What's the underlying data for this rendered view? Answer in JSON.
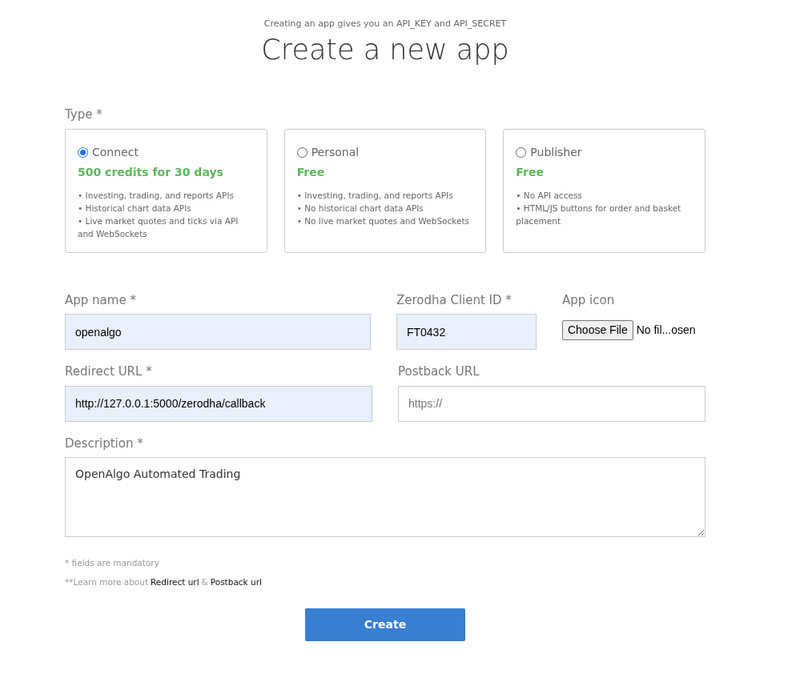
{
  "header": {
    "subtitle": "Creating an app gives you an API_KEY and API_SECRET",
    "title": "Create a new app"
  },
  "type": {
    "label": "Type *",
    "options": [
      {
        "name": "Connect",
        "selected": true,
        "price": "500 credits for 30 days",
        "features": [
          "• Investing, trading, and reports APIs",
          "• Historical chart data APIs",
          "• Live market quotes and ticks via API and WebSockets"
        ]
      },
      {
        "name": "Personal",
        "selected": false,
        "price": "Free",
        "features": [
          "• Investing, trading, and reports APIs",
          "• No historical chart data APIs",
          "• No live market quotes and WebSockets"
        ]
      },
      {
        "name": "Publisher",
        "selected": false,
        "price": "Free",
        "features": [
          "• No API access",
          "• HTML/JS buttons for order and basket placement"
        ]
      }
    ]
  },
  "app_name": {
    "label": "App name *",
    "value": "openalgo"
  },
  "client_id": {
    "label": "Zerodha Client ID *",
    "value": "FT0432"
  },
  "app_icon": {
    "label": "App icon",
    "button": "Choose File",
    "status": "No fil...osen"
  },
  "redirect_url": {
    "label": "Redirect URL *",
    "value": "http://127.0.0.1:5000/zerodha/callback"
  },
  "postback_url": {
    "label": "Postback URL",
    "placeholder": "https://"
  },
  "description": {
    "label": "Description *",
    "value": "OpenAlgo Automated Trading"
  },
  "notes": {
    "mandatory": "* fields are mandatory",
    "learn_more": "**Learn more about",
    "redirect_link": "Redirect url",
    "separator": "&",
    "postback_link": "Postback url"
  },
  "submit": "Create"
}
